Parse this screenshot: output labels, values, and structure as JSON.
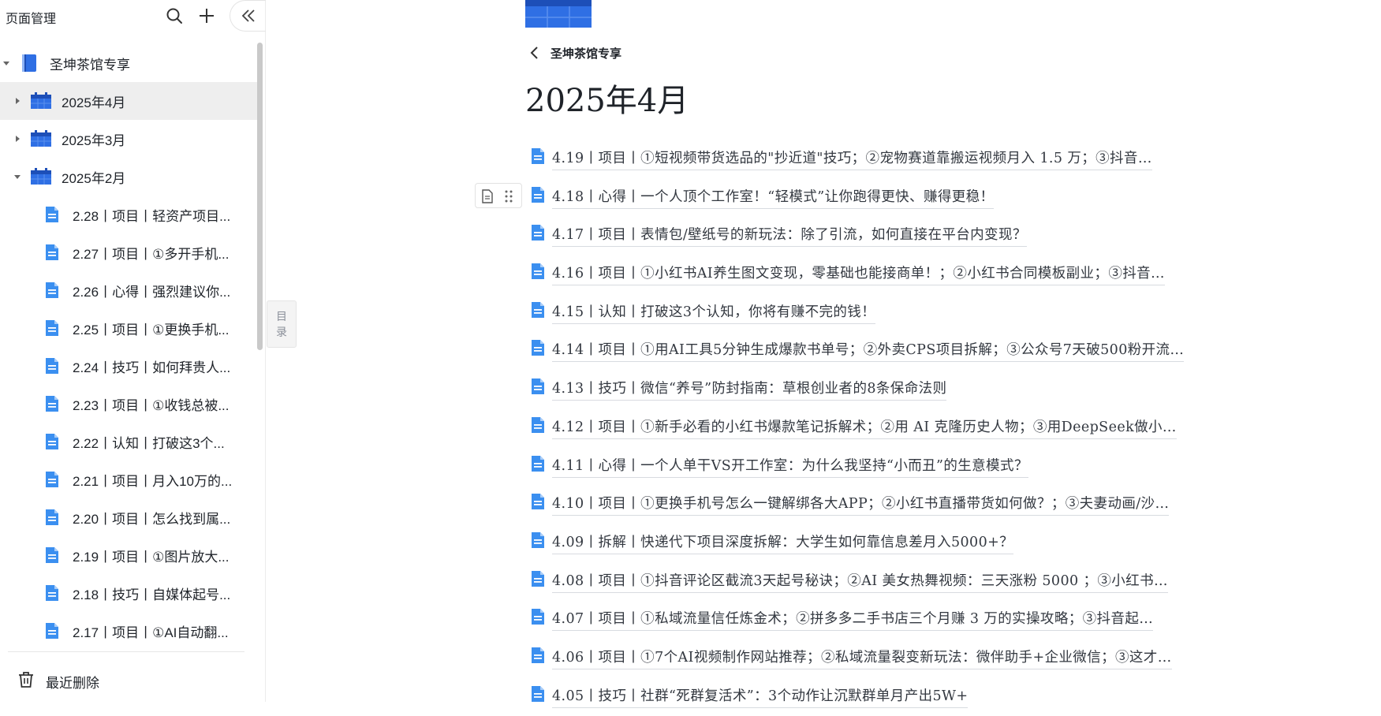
{
  "sidebar": {
    "title": "页面管理",
    "root": {
      "label": "圣坤茶馆专享",
      "icon": "book-icon"
    },
    "months": [
      {
        "label": "2025年4月",
        "expanded": false,
        "selected": true
      },
      {
        "label": "2025年3月",
        "expanded": false,
        "selected": false
      },
      {
        "label": "2025年2月",
        "expanded": true,
        "selected": false
      }
    ],
    "docs": [
      "2.28丨项目丨轻资产项目...",
      "2.27丨项目丨①多开手机...",
      "2.26丨心得丨强烈建议你...",
      "2.25丨项目丨①更换手机...",
      "2.24丨技巧丨如何拜贵人...",
      "2.23丨项目丨①收钱总被...",
      "2.22丨认知丨打破这3个...",
      "2.21丨项目丨月入10万的...",
      "2.20丨项目丨怎么找到属...",
      "2.19丨项目丨①图片放大...",
      "2.18丨技巧丨自媒体起号...",
      "2.17丨项目丨①AI自动翻..."
    ],
    "trash_label": "最近删除"
  },
  "toc_tab": {
    "line1": "目",
    "line2": "录"
  },
  "main": {
    "back_label": "圣坤茶馆专享",
    "title": "2025年4月",
    "items": [
      "4.19丨项目丨①短视频带货选品的\"抄近道\"技巧；②宠物赛道靠搬运视频月入 1.5 万；③抖音…",
      "4.18丨心得丨一个人顶个工作室！“轻模式”让你跑得更快、赚得更稳！",
      "4.17丨项目丨表情包/壁纸号的新玩法：除了引流，如何直接在平台内变现？",
      "4.16丨项目丨①小红书AI养生图文变现，零基础也能接商单！；②小红书合同模板副业；③抖音…",
      "4.15丨认知丨打破这3个认知，你将有赚不完的钱！",
      "4.14丨项目丨①用AI工具5分钟生成爆款书单号；②外卖CPS项目拆解；③公众号7天破500粉开流…",
      "4.13丨技巧丨微信“养号”防封指南：草根创业者的8条保命法则",
      "4.12丨项目丨①新手必看的小红书爆款笔记拆解术；②用 AI 克隆历史人物；③用DeepSeek做小…",
      "4.11丨心得丨一个人单干VS开工作室：为什么我坚持“小而丑”的生意模式？",
      "4.10丨项目丨①更换手机号怎么一键解绑各大APP；②小红书直播带货如何做？；③夫妻动画/沙…",
      "4.09丨拆解丨快递代下项目深度拆解：大学生如何靠信息差月入5000+？",
      "4.08丨项目丨①抖音评论区截流3天起号秘诀；②AI 美女热舞视频：三天涨粉 5000 ；③小红书…",
      "4.07丨项目丨①私域流量信任炼金术；②拼多多二手书店三个月赚 3 万的实操攻略；③抖音起…",
      "4.06丨项目丨①7个AI视频制作网站推荐；②私域流量裂变新玩法：微伴助手+企业微信；③这才…",
      "4.05丨技巧丨社群“死群复活术”：3个动作让沉默群单月产出5W+"
    ]
  },
  "colors": {
    "accent_blue": "#2f6fe4",
    "doc_icon_blue": "#3b8ff0",
    "selected_row_bg": "#eeeeee"
  }
}
